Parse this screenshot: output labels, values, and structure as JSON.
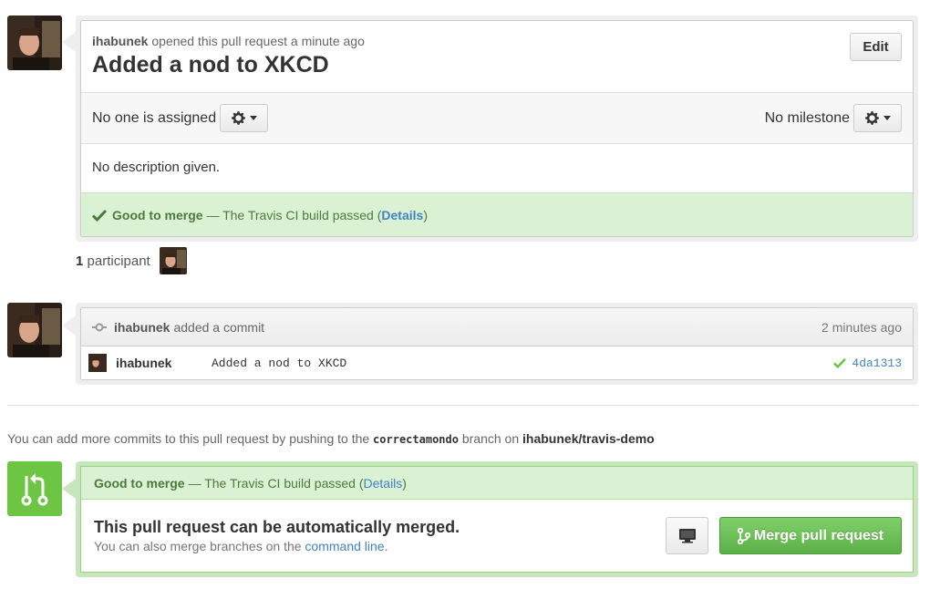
{
  "pull_request": {
    "author": "ihabunek",
    "opened_text": "opened this pull request a minute ago",
    "title": "Added a nod to XKCD",
    "edit_label": "Edit",
    "assignee_text": "No one is assigned",
    "milestone_text": "No milestone",
    "description": "No description given.",
    "status": {
      "label": "Good to merge",
      "text": "— The Travis CI build passed (",
      "link": "Details",
      "close": ")"
    }
  },
  "participants": {
    "count": "1",
    "label": "participant"
  },
  "commit_block": {
    "author": "ihabunek",
    "action": "added a commit",
    "time": "2 minutes ago",
    "commit": {
      "author": "ihabunek",
      "message": "Added a nod to XKCD",
      "sha": "4da1313"
    }
  },
  "push_note": {
    "prefix": "You can add more commits to this pull request by pushing to the",
    "branch": "correctamondo",
    "middle": "branch on",
    "repo": "ihabunek/travis-demo"
  },
  "merge": {
    "status_label": "Good to merge",
    "status_text": "— The Travis CI build passed (",
    "status_link": "Details",
    "status_close": ")",
    "title": "This pull request can be automatically merged.",
    "sub_prefix": "You can also merge branches on the",
    "sub_link": "command line",
    "sub_suffix": ".",
    "button_label": "Merge pull request"
  },
  "colors": {
    "success_green": "#6cc644",
    "status_bg": "#dbf1d3",
    "link": "#4183c4"
  },
  "icons": [
    "gear-icon",
    "check-icon",
    "commit-icon",
    "merge-icon",
    "monitor-icon",
    "branch-icon"
  ]
}
